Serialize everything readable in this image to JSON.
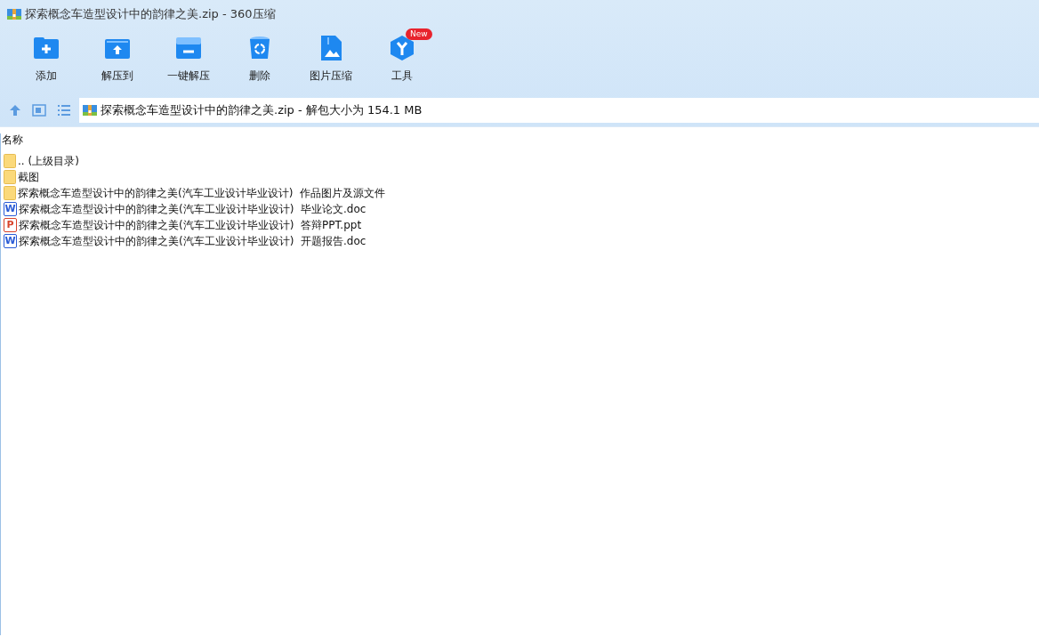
{
  "window": {
    "title": "探索概念车造型设计中的韵律之美.zip - 360压缩"
  },
  "toolbar": [
    {
      "label": "添加",
      "kind": "add"
    },
    {
      "label": "解压到",
      "kind": "extract-to"
    },
    {
      "label": "一键解压",
      "kind": "quick-extract"
    },
    {
      "label": "删除",
      "kind": "delete"
    },
    {
      "label": "图片压缩",
      "kind": "image"
    },
    {
      "label": "工具",
      "kind": "tools",
      "badge": "New"
    }
  ],
  "address": {
    "path": "探索概念车造型设计中的韵律之美.zip - 解包大小为 154.1 MB"
  },
  "list": {
    "columns": [
      "名称"
    ],
    "rows": [
      {
        "kind": "folder",
        "name": ".. (上级目录)"
      },
      {
        "kind": "folder",
        "name": "截图"
      },
      {
        "kind": "folder",
        "name": "探索概念车造型设计中的韵律之美(汽车工业设计毕业设计)  作品图片及源文件"
      },
      {
        "kind": "word",
        "icon_letter": "W",
        "name": "探索概念车造型设计中的韵律之美(汽车工业设计毕业设计)  毕业论文.doc"
      },
      {
        "kind": "ppt",
        "icon_letter": "P",
        "name": "探索概念车造型设计中的韵律之美(汽车工业设计毕业设计)  答辩PPT.ppt"
      },
      {
        "kind": "word",
        "icon_letter": "W",
        "name": "探索概念车造型设计中的韵律之美(汽车工业设计毕业设计)  开题报告.doc"
      }
    ]
  }
}
